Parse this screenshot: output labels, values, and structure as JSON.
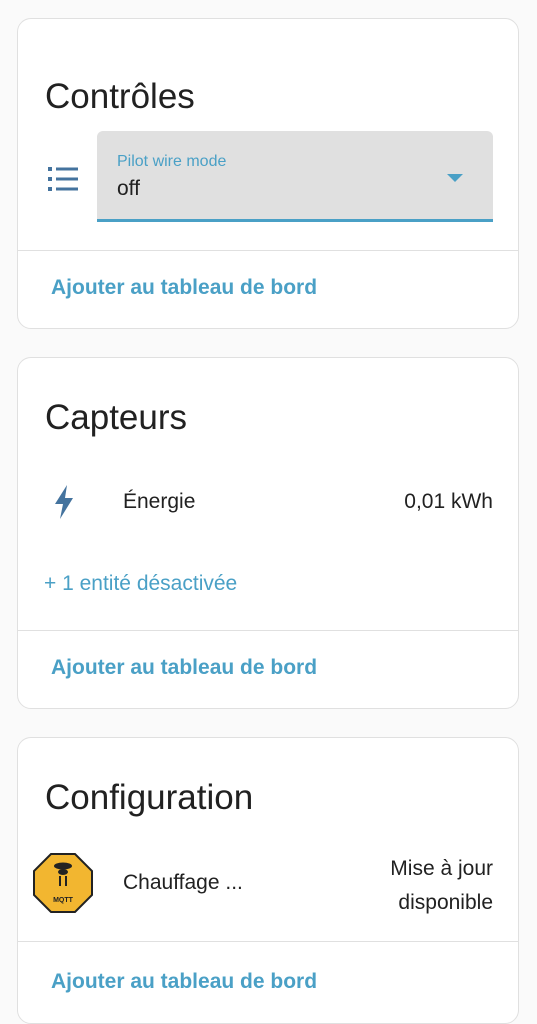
{
  "controls": {
    "title": "Contrôles",
    "select": {
      "label": "Pilot wire mode",
      "value": "off"
    },
    "add_to_dashboard": "Ajouter au tableau de bord"
  },
  "sensors": {
    "title": "Capteurs",
    "items": [
      {
        "name": "Énergie",
        "value": "0,01 kWh",
        "icon": "flash-icon"
      }
    ],
    "disabled_entities": "+ 1 entité désactivée",
    "add_to_dashboard": "Ajouter au tableau de bord"
  },
  "configuration": {
    "title": "Configuration",
    "items": [
      {
        "name": "Chauffage ...",
        "status_line1": "Mise à jour",
        "status_line2": "disponible",
        "icon": "mqtt-icon"
      }
    ],
    "add_to_dashboard": "Ajouter au tableau de bord"
  },
  "colors": {
    "accent": "#4aa0c6",
    "icon": "#44739e",
    "card_border": "#e0e0e0",
    "mqtt_badge": "#f2b630"
  }
}
